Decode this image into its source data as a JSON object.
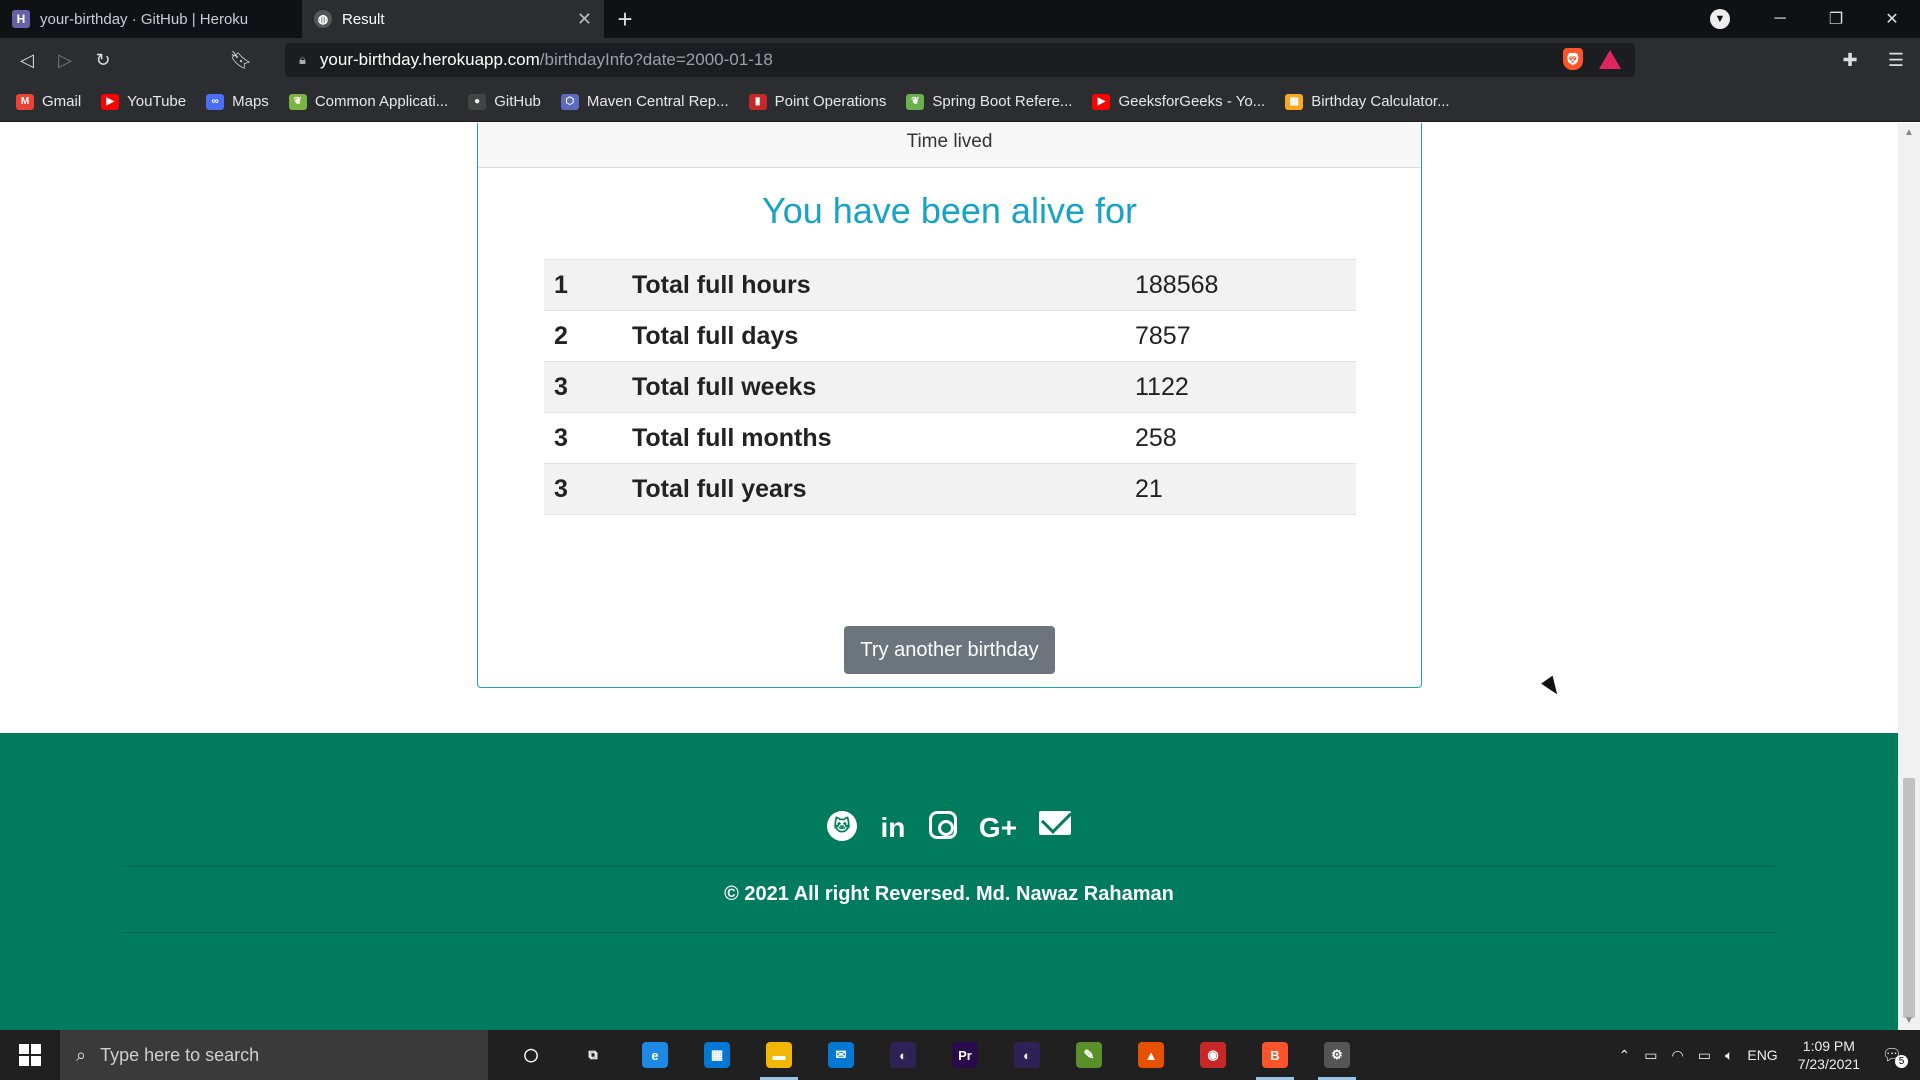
{
  "tabs": [
    {
      "title": "your-birthday · GitHub | Heroku",
      "favicon": "heroku-icon",
      "active": false
    },
    {
      "title": "Result",
      "favicon": "globe-icon",
      "active": true
    }
  ],
  "address_bar": {
    "host": "your-birthday.herokuapp.com",
    "path": "/birthdayInfo?date=2000-01-18"
  },
  "bookmarks": [
    {
      "label": "Gmail",
      "icon": "gmail-icon",
      "color": "#ea4335"
    },
    {
      "label": "YouTube",
      "icon": "youtube-icon",
      "color": "#ff0000"
    },
    {
      "label": "Maps",
      "icon": "maps-icon",
      "color": "#4c6ef5"
    },
    {
      "label": "Common Applicati...",
      "icon": "leaf-icon",
      "color": "#7cb342"
    },
    {
      "label": "GitHub",
      "icon": "github-icon",
      "color": "#444444"
    },
    {
      "label": "Maven Central Rep...",
      "icon": "hexagon-icon",
      "color": "#5c6bc0"
    },
    {
      "label": "Point Operations",
      "icon": "bookmark-page-icon",
      "color": "#c62828"
    },
    {
      "label": "Spring Boot Refere...",
      "icon": "leaf-icon",
      "color": "#6ab04c"
    },
    {
      "label": "GeeksforGeeks - Yo...",
      "icon": "youtube-icon",
      "color": "#ff0000"
    },
    {
      "label": "Birthday Calculator...",
      "icon": "calculator-icon",
      "color": "#f9a825"
    }
  ],
  "card": {
    "header": "Time lived",
    "title": "You have been alive for",
    "rows": [
      {
        "num": "1",
        "label": "Total full hours",
        "value": "188568"
      },
      {
        "num": "2",
        "label": "Total full days",
        "value": "7857"
      },
      {
        "num": "3",
        "label": "Total full weeks",
        "value": "1122"
      },
      {
        "num": "3",
        "label": "Total full months",
        "value": "258"
      },
      {
        "num": "3",
        "label": "Total full years",
        "value": "21"
      }
    ]
  },
  "try_button": "Try another birthday",
  "footer": {
    "socials": [
      "github-icon",
      "linkedin-icon",
      "instagram-icon",
      "google-plus-icon",
      "envelope-icon"
    ],
    "linkedin_text": "in",
    "gplus_text": "G+",
    "copyright": "© 2021 All right Reversed. Md. Nawaz Rahaman",
    "bg_color": "#007b5e"
  },
  "taskbar": {
    "search_placeholder": "Type here to search",
    "apps": [
      {
        "name": "cortana-icon",
        "color": "#202020",
        "glyph": "◯"
      },
      {
        "name": "task-view-icon",
        "color": "#202020",
        "glyph": "⧉"
      },
      {
        "name": "edge-icon",
        "color": "#1e88e5",
        "glyph": "e"
      },
      {
        "name": "store-icon",
        "color": "#0078d4",
        "glyph": "▦"
      },
      {
        "name": "file-explorer-icon",
        "color": "#f2b705",
        "glyph": "▬"
      },
      {
        "name": "mail-icon",
        "color": "#0078d4",
        "glyph": "✉"
      },
      {
        "name": "eclipse-icon",
        "color": "#2c2255",
        "glyph": "◐"
      },
      {
        "name": "premiere-icon",
        "color": "#2a0b4a",
        "glyph": "Pr"
      },
      {
        "name": "eclipse-icon-2",
        "color": "#2c2255",
        "glyph": "◐"
      },
      {
        "name": "notepad-icon",
        "color": "#5a8f29",
        "glyph": "✎"
      },
      {
        "name": "matlab-icon",
        "color": "#e65100",
        "glyph": "▲"
      },
      {
        "name": "record-icon",
        "color": "#c62828",
        "glyph": "◉"
      },
      {
        "name": "brave-icon",
        "color": "#fb542b",
        "glyph": "B"
      },
      {
        "name": "settings-icon",
        "color": "#555555",
        "glyph": "⚙"
      }
    ],
    "language": "ENG",
    "time": "1:09 PM",
    "date": "7/23/2021",
    "notification_count": "5"
  }
}
